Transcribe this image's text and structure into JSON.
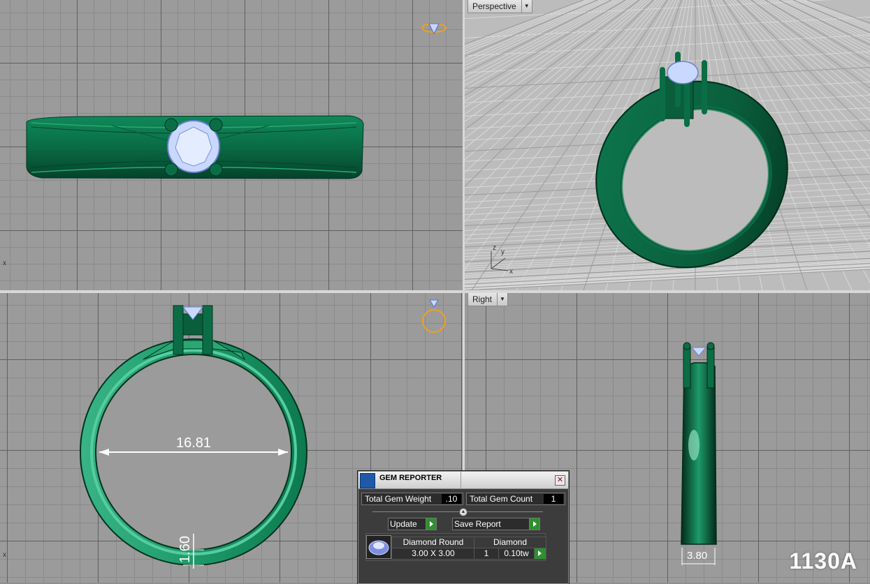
{
  "viewports": {
    "top": {
      "axis_label": "x"
    },
    "perspective": {
      "title": "Perspective",
      "axis_x": "x",
      "axis_y": "y",
      "axis_z": "z"
    },
    "front": {
      "axis_label": "x",
      "dimension_inner": "16.81",
      "dimension_band": "1.60"
    },
    "right": {
      "title": "Right",
      "dimension_width": "3.80"
    }
  },
  "watermark": "1130A",
  "gem_reporter": {
    "title": "GEM REPORTER",
    "total_weight_label": "Total Gem Weight",
    "total_weight_value": ".10",
    "total_count_label": "Total Gem Count",
    "total_count_value": "1",
    "update_label": "Update",
    "save_report_label": "Save Report",
    "rows": [
      {
        "shape": "Diamond Round",
        "material": "Diamond",
        "size": "3.00 X 3.00",
        "count": "1",
        "weight": "0.10tw"
      }
    ]
  },
  "colors": {
    "ring_green": "#0a6b45",
    "ring_green_light": "#3cb98a",
    "gem_blue": "#c9d8ff",
    "grid_bg": "#9b9b9b"
  }
}
